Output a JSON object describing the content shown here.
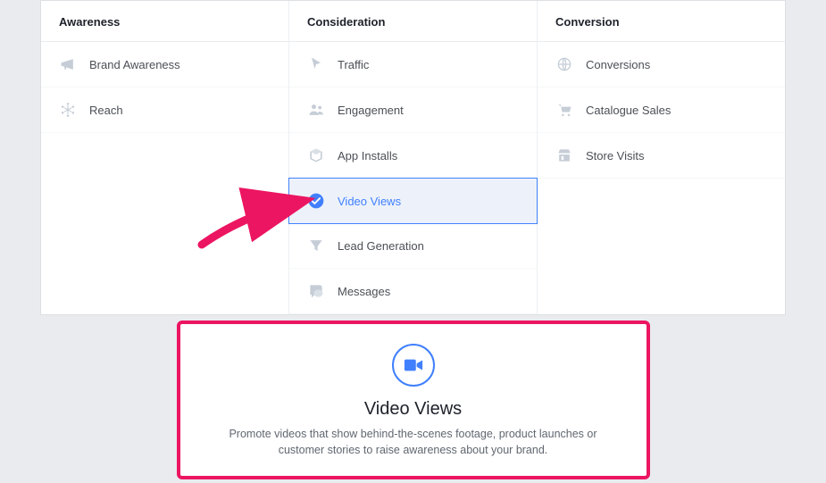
{
  "columns": {
    "awareness": {
      "header": "Awareness",
      "items": [
        {
          "label": "Brand Awareness",
          "icon": "megaphone-icon"
        },
        {
          "label": "Reach",
          "icon": "snowflake-icon"
        }
      ]
    },
    "consideration": {
      "header": "Consideration",
      "items": [
        {
          "label": "Traffic",
          "icon": "cursor-icon"
        },
        {
          "label": "Engagement",
          "icon": "people-icon"
        },
        {
          "label": "App Installs",
          "icon": "box-icon"
        },
        {
          "label": "Video Views",
          "icon": "check-circle-icon",
          "selected": true
        },
        {
          "label": "Lead Generation",
          "icon": "funnel-icon"
        },
        {
          "label": "Messages",
          "icon": "chat-icon"
        }
      ]
    },
    "conversion": {
      "header": "Conversion",
      "items": [
        {
          "label": "Conversions",
          "icon": "globe-icon"
        },
        {
          "label": "Catalogue Sales",
          "icon": "cart-icon"
        },
        {
          "label": "Store Visits",
          "icon": "store-icon"
        }
      ]
    }
  },
  "detail": {
    "title": "Video Views",
    "description": "Promote videos that show behind-the-scenes footage, product launches or customer stories to raise awareness about your brand."
  },
  "annotation": {
    "arrow_color": "#ec1561",
    "highlight_color": "#ec1561"
  }
}
